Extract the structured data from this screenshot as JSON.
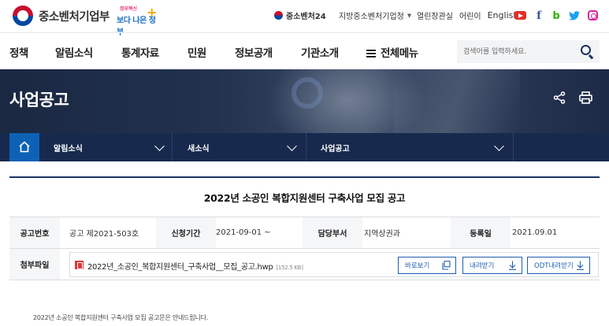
{
  "header": {
    "logo_text": "중소벤처기업부",
    "slogan_small": "정부혁신",
    "slogan_main": "보다 나은 정부",
    "slogan_plus": "+",
    "utility": {
      "site24": "중소벤처24",
      "region_label": "지방중소벤처기업청",
      "links": [
        "열린장관실",
        "어린이",
        "English"
      ]
    },
    "social": [
      "youtube-icon",
      "facebook-icon",
      "blog-icon",
      "twitter-icon",
      "instagram-icon"
    ]
  },
  "gnb": {
    "items": [
      "정책",
      "알림소식",
      "통계자료",
      "민원",
      "정보공개",
      "기관소개"
    ],
    "all_menu": "전체메뉴",
    "search_placeholder": "검색어를 입력하세요."
  },
  "banner": {
    "title": "사업공고"
  },
  "location": {
    "items": [
      "알림소식",
      "새소식",
      "사업공고"
    ]
  },
  "post": {
    "title": "2022년 소공인 복합지원센터 구축사업 모집 공고",
    "fields": [
      {
        "label": "공고번호",
        "value": "공고 제2021-503호"
      },
      {
        "label": "신청기간",
        "value": "2021-09-01 ~"
      },
      {
        "label": "담당부서",
        "value": "지역상권과"
      },
      {
        "label": "등록일",
        "value": "2021.09.01"
      }
    ],
    "attachment": {
      "label": "첨부파일",
      "file_name": "2022년_소공인_복합지원센터_구축사업__모집_공고.hwp",
      "file_size": "[152.5 KB]",
      "buttons": [
        "바로보기",
        "내려받기",
        "ODT내려받기"
      ]
    },
    "description": "2022년 소공인 복합지원센터 구축사업 모집 공고문은 안내드립니다."
  },
  "colors": {
    "navy": "#172a4e",
    "primary_blue": "#1f5fb0",
    "home_blue": "#0d62b5"
  }
}
